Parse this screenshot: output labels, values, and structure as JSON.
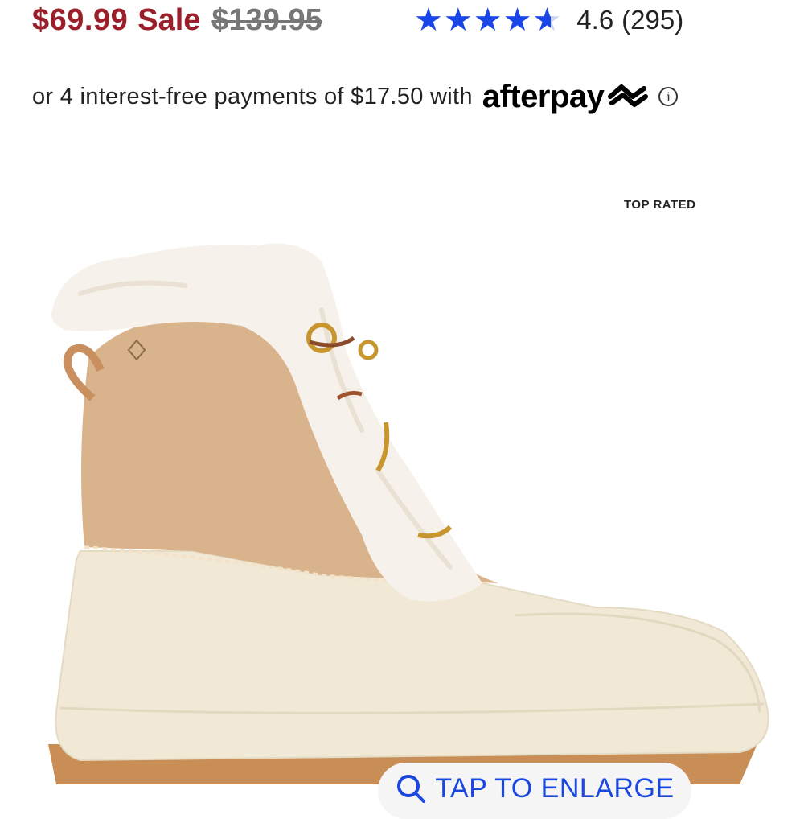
{
  "price": {
    "sale_price": "$69.99",
    "sale_label": "Sale",
    "original_price": "$139.95"
  },
  "rating": {
    "stars_glyphs": "★★★★★",
    "value": "4.6",
    "count": "(295)",
    "stars_fill_fraction": 0.92,
    "star_color": "#1a45e8"
  },
  "afterpay": {
    "text": "or 4 interest-free payments of $17.50 with",
    "logo": "afterpay",
    "info_glyph": "i"
  },
  "badge": {
    "label": "TOP RATED"
  },
  "enlarge": {
    "label": "TAP TO ENLARGE",
    "icon": "search-icon"
  },
  "colors": {
    "sale": "#9b1f2b",
    "link": "#1a47e0"
  }
}
